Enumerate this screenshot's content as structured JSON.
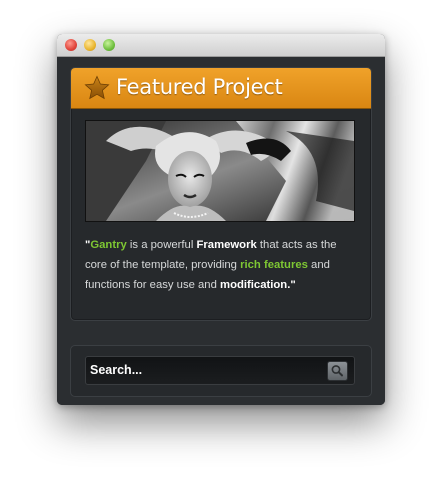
{
  "window": {
    "controls": [
      "close",
      "minimize",
      "maximize"
    ]
  },
  "featured": {
    "title": "Featured Project",
    "icon": "star-icon",
    "accent_color": "#e9951a",
    "image": "black-and-white portrait photo",
    "text": {
      "quote_open": "\"",
      "brand": "Gantry",
      "part1": " is a powerful ",
      "framework": "Framework",
      "part2": " that acts as the core of the template, providing ",
      "rich_features": "rich features",
      "part3": " and functions for easy use and ",
      "modification": "modification",
      "quote_close": ".\""
    }
  },
  "search": {
    "placeholder": "Search...",
    "button_icon": "magnifier-icon"
  }
}
